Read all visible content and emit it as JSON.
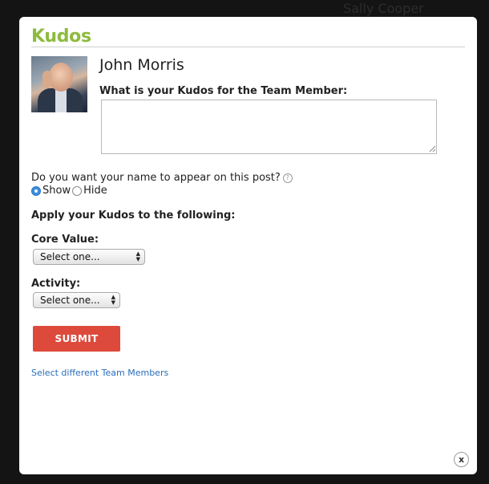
{
  "background": {
    "name": "Sally Cooper"
  },
  "modal": {
    "title": "Kudos",
    "member_name": "John Morris",
    "question": "What is your Kudos for the Team Member:",
    "kudos_text": "",
    "anonymity_question": "Do you want your name to appear on this post?",
    "visibility_options": [
      {
        "label": "Show",
        "selected": true
      },
      {
        "label": "Hide",
        "selected": false
      }
    ],
    "apply_heading": "Apply your Kudos to the following:",
    "core_value": {
      "label": "Core Value:",
      "selected": "Select one..."
    },
    "activity": {
      "label": "Activity:",
      "selected": "Select one..."
    },
    "submit_label": "SUBMIT",
    "select_members_link": "Select different Team Members",
    "close_icon": "close-icon",
    "help_icon": "help-icon"
  },
  "colors": {
    "title": "#8dbb3e",
    "submit": "#dd4a3c",
    "link": "#2a6ebb",
    "radio_selected": "#3a8fe0"
  }
}
